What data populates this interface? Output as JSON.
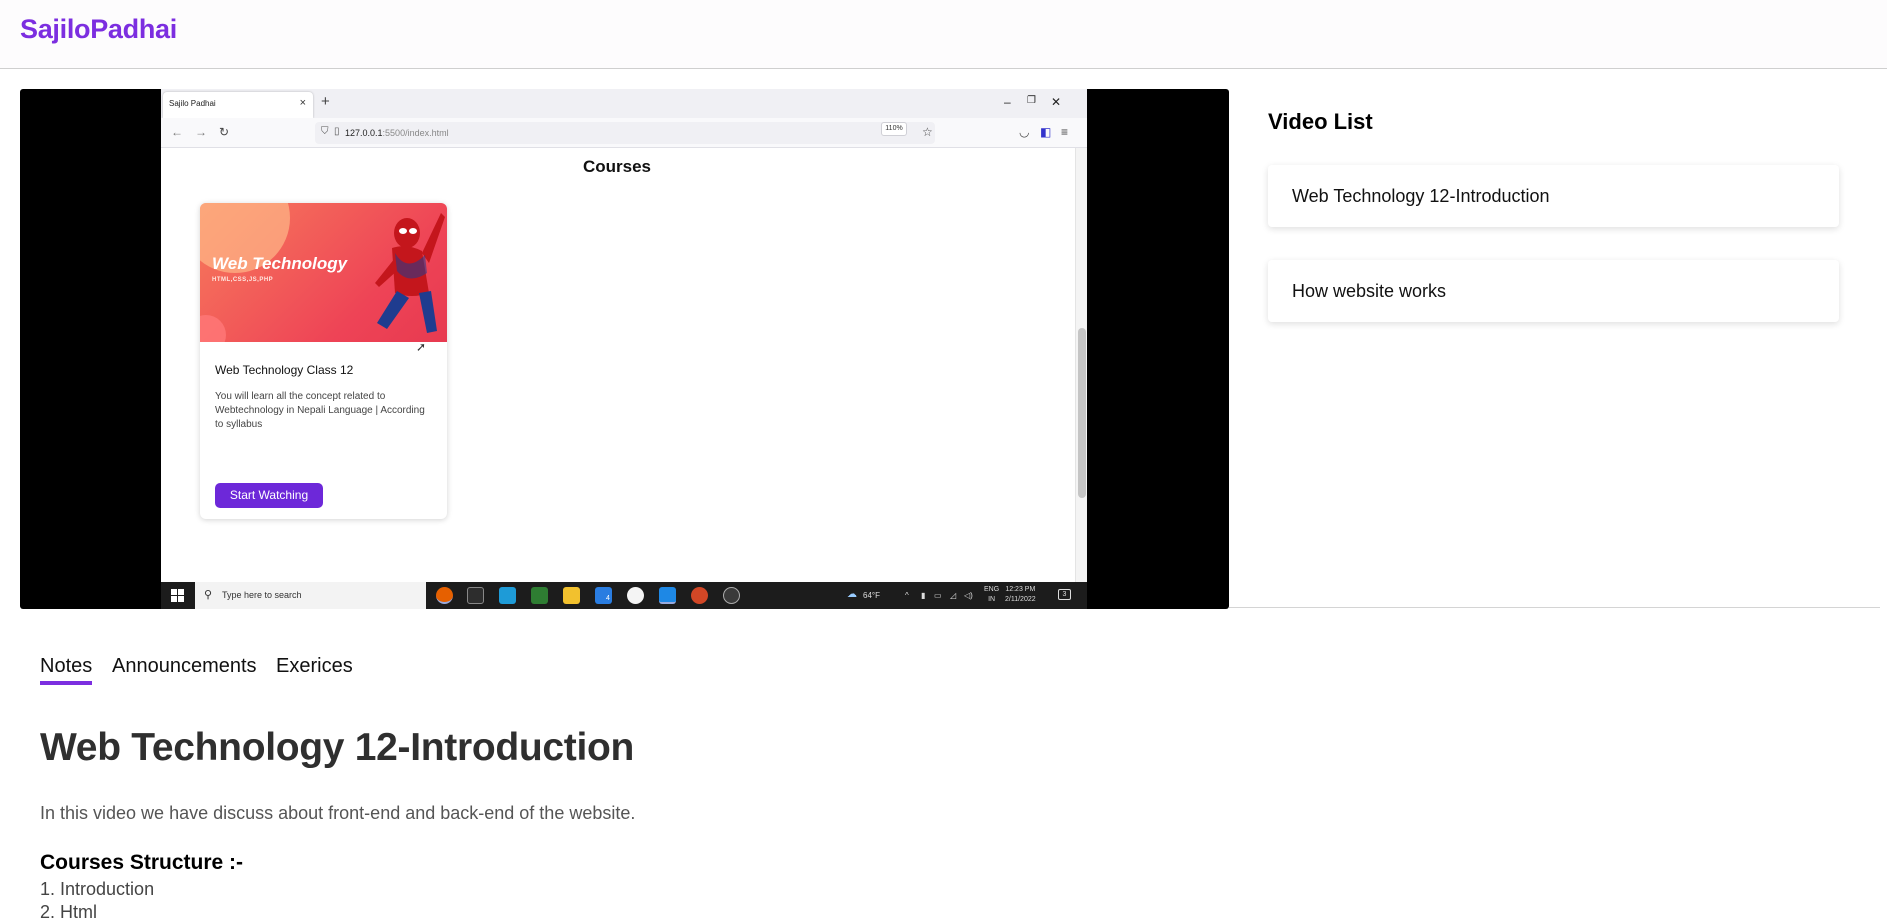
{
  "app": {
    "brand": "SajiloPadhai"
  },
  "player": {
    "browser": {
      "tab_title": "Sajilo Padhai",
      "url_host": "127.0.0.1",
      "url_path": ":5500/index.html",
      "zoom": "110%"
    },
    "page": {
      "heading": "Courses",
      "card": {
        "image_title": "Web Technology",
        "image_subtitle": "HTML,CSS,JS,PHP",
        "title": "Web Technology Class 12",
        "description": "You will learn all the concept related to Webtechnology in Nepali Language | According to syllabus",
        "button": "Start Watching"
      }
    },
    "taskbar": {
      "search_placeholder": "Type here to search",
      "weather": "64°F",
      "lang_line1": "ENG",
      "lang_line2": "IN",
      "time": "12:23 PM",
      "date": "2/11/2022",
      "notifications": "3",
      "app_badge": "4"
    }
  },
  "video_list": {
    "title": "Video List",
    "items": [
      {
        "label": "Web Technology 12-Introduction"
      },
      {
        "label": "How website works"
      }
    ]
  },
  "tabs": [
    {
      "label": "Notes",
      "active": true
    },
    {
      "label": "Announcements",
      "active": false
    },
    {
      "label": "Exerices",
      "active": false
    }
  ],
  "notes": {
    "title": "Web Technology 12-Introduction",
    "description": "In this video we have discuss about front-end and back-end of the website.",
    "structure_title": "Courses Structure :-",
    "structure_items": [
      "1. Introduction",
      "2. Html"
    ]
  },
  "colors": {
    "accent": "#7c2ee0",
    "button": "#6d28d9"
  }
}
